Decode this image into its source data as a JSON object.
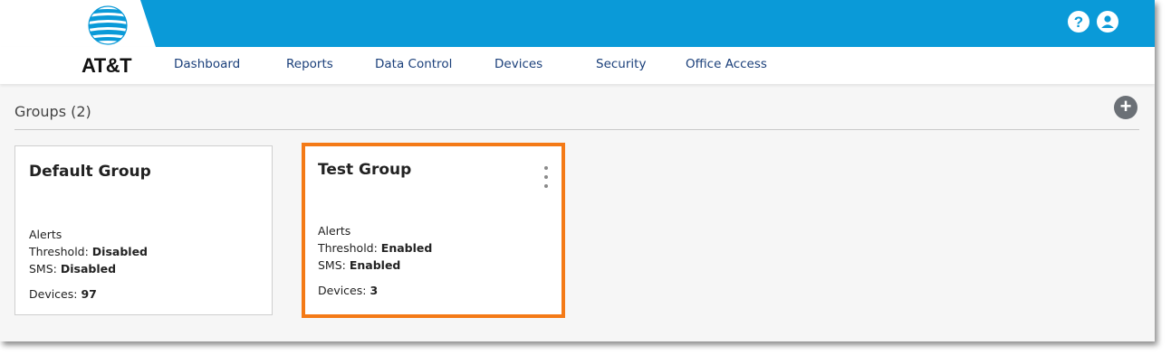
{
  "brand": {
    "name": "AT&T",
    "globe_color": "#0a9ad8"
  },
  "header": {
    "bar_color": "#0a9ad8",
    "icons": [
      "help-icon",
      "user-account-icon"
    ],
    "help_glyph": "?"
  },
  "nav": {
    "items": [
      {
        "label": "Dashboard"
      },
      {
        "label": "Reports"
      },
      {
        "label": "Data Control"
      },
      {
        "label": "Devices"
      },
      {
        "label": "Security"
      },
      {
        "label": "Office Access"
      }
    ]
  },
  "groups": {
    "title": "Groups (2)",
    "add_icon": "plus-icon",
    "cards": [
      {
        "name": "Default Group",
        "alerts_label": "Alerts",
        "threshold_label": "Threshold: ",
        "threshold_value": "Disabled",
        "sms_label": "SMS: ",
        "sms_value": "Disabled",
        "devices_label": "Devices: ",
        "devices_value": "97",
        "selected": false
      },
      {
        "name": "Test Group",
        "alerts_label": "Alerts",
        "threshold_label": "Threshold: ",
        "threshold_value": "Enabled",
        "sms_label": "SMS: ",
        "sms_value": "Enabled",
        "devices_label": "Devices: ",
        "devices_value": "3",
        "selected": true,
        "highlight_color": "#f47a16",
        "menu_icon": "kebab-menu-icon"
      }
    ]
  }
}
